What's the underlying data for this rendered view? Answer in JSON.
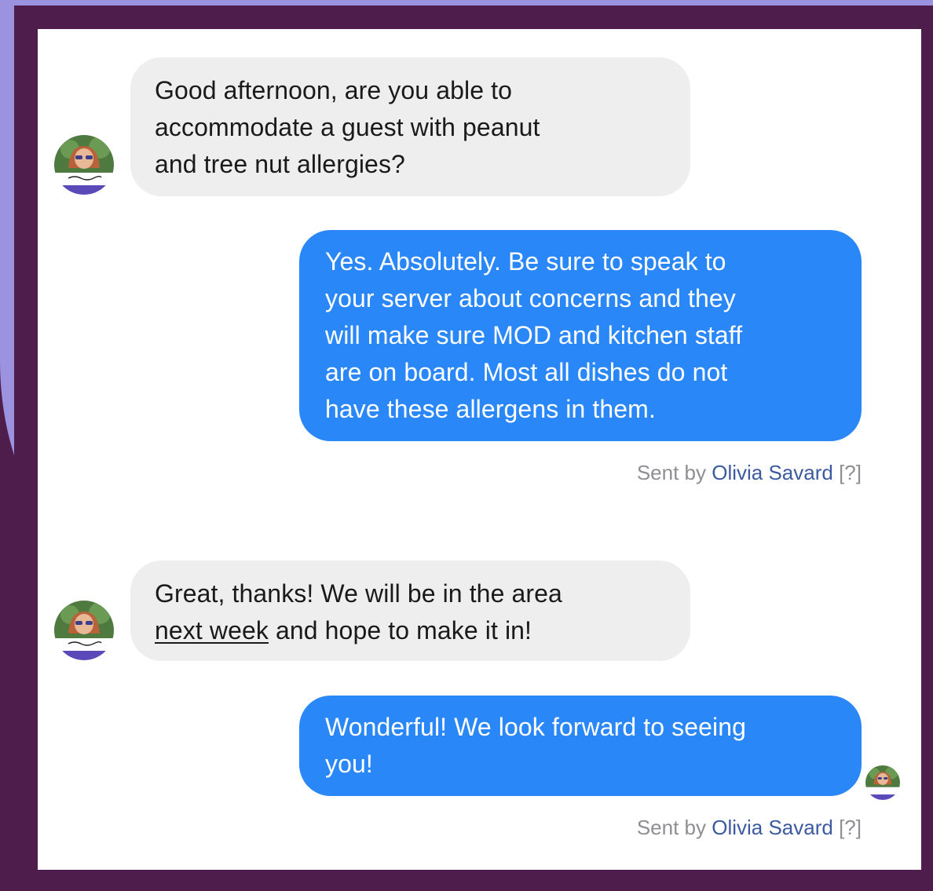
{
  "messages": [
    {
      "direction": "incoming",
      "lines": [
        "Good afternoon, are you able to",
        "accommodate a guest with peanut",
        "and tree nut allergies?"
      ]
    },
    {
      "direction": "outgoing",
      "lines": [
        "Yes. Absolutely. Be sure to speak to",
        "your server about concerns and they",
        "will make sure MOD and kitchen staff",
        "are on board. Most all dishes do not",
        "have these allergens in them."
      ],
      "sent_by": {
        "prefix": "Sent by",
        "name": "Olivia Savard",
        "help": "[?]"
      }
    },
    {
      "direction": "incoming",
      "lines": [
        "Great, thanks! We will be in the area",
        "and hope to make it in!"
      ],
      "underlined": "next week"
    },
    {
      "direction": "outgoing",
      "lines": [
        "Wonderful! We look forward to seeing",
        "you!"
      ],
      "sent_by": {
        "prefix": "Sent by",
        "name": "Olivia Savard",
        "help": "[?]"
      }
    }
  ],
  "colors": {
    "outer_purple": "#4f1d4b",
    "lavender": "#9b93df",
    "incoming_bubble": "#eeeeef",
    "outgoing_bubble": "#2a87f8",
    "sender_name": "#3b5aa0"
  },
  "avatar_icon": "profile-photo-icon"
}
